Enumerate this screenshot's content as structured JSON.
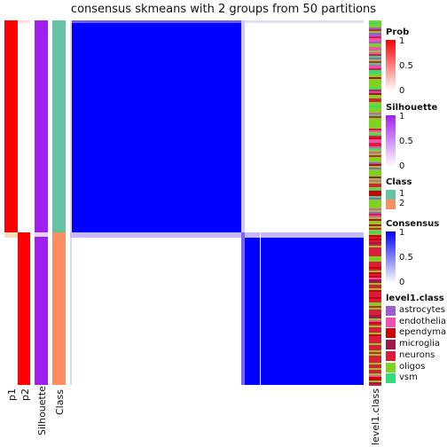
{
  "chart_data": {
    "type": "heatmap",
    "title": "consensus skmeans with 2 groups from 50 partitions",
    "columns": [
      "p1",
      "p2",
      "Silhouette",
      "Class"
    ],
    "annotation_column": "level1.class",
    "groups": [
      {
        "class": "1",
        "fraction": 0.58,
        "p1": 1,
        "p2": 0,
        "silhouette": 1,
        "consensus_within": 1
      },
      {
        "class": "2",
        "fraction": 0.42,
        "p1": 0,
        "p2": 1,
        "silhouette": 1,
        "consensus_within": 1
      }
    ],
    "legends": {
      "prob": {
        "title": "Prob",
        "ticks": [
          "1",
          "0.5",
          "0"
        ],
        "color": "#FF0000"
      },
      "silhouette": {
        "title": "Silhouette",
        "ticks": [
          "1",
          "0.5",
          "0"
        ],
        "color": "#A020F0"
      },
      "class": {
        "title": "Class",
        "items": [
          {
            "label": "1",
            "color": "#66C2A5"
          },
          {
            "label": "2",
            "color": "#FC8D62"
          }
        ]
      },
      "consensus": {
        "title": "Consensus",
        "ticks": [
          "1",
          "0.5",
          "0"
        ],
        "color": "#0000FF"
      },
      "level1": {
        "title": "level1.class",
        "items": [
          {
            "label": "astrocytes",
            "color": "#9E5BD6"
          },
          {
            "label": "endothelial",
            "color": "#F050B4"
          },
          {
            "label": "ependymal",
            "color": "#D00000"
          },
          {
            "label": "microglia",
            "color": "#A0174A"
          },
          {
            "label": "neurons",
            "color": "#D91E3C"
          },
          {
            "label": "oligos",
            "color": "#7ED321"
          },
          {
            "label": "vsm",
            "color": "#2EDC7A"
          }
        ]
      }
    }
  }
}
